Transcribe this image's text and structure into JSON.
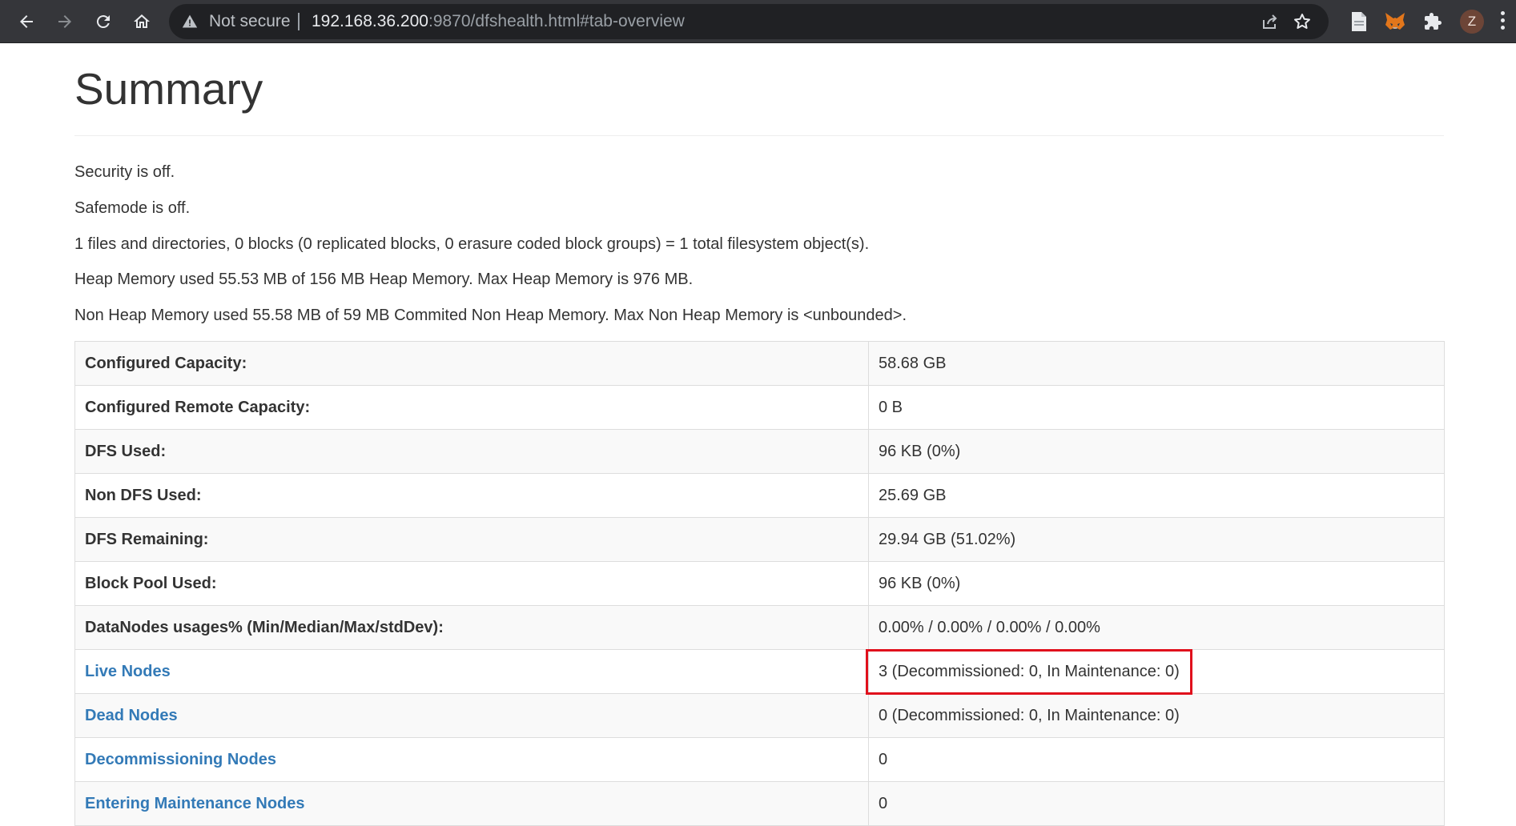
{
  "browser": {
    "not_secure_label": "Not secure",
    "url_host": "192.168.36.200",
    "url_rest": ":9870/dfshealth.html#tab-overview",
    "profile_initial": "Z",
    "icons": {
      "back": "arrow-left-icon",
      "forward": "arrow-right-icon",
      "reload": "reload-icon",
      "home": "home-icon",
      "warning": "warning-triangle-icon",
      "share": "share-icon",
      "bookmark": "star-icon",
      "document": "document-icon",
      "metamask": "fox-extension-icon",
      "extensions": "puzzle-icon",
      "menu": "kebab-menu-icon"
    }
  },
  "page": {
    "title": "Summary",
    "info": [
      "Security is off.",
      "Safemode is off.",
      "1 files and directories, 0 blocks (0 replicated blocks, 0 erasure coded block groups) = 1 total filesystem object(s).",
      "Heap Memory used 55.53 MB of 156 MB Heap Memory. Max Heap Memory is 976 MB.",
      "Non Heap Memory used 55.58 MB of 59 MB Commited Non Heap Memory. Max Non Heap Memory is <unbounded>."
    ],
    "rows": [
      {
        "label": "Configured Capacity:",
        "value": "58.68 GB"
      },
      {
        "label": "Configured Remote Capacity:",
        "value": "0 B"
      },
      {
        "label": "DFS Used:",
        "value": "96 KB (0%)"
      },
      {
        "label": "Non DFS Used:",
        "value": "25.69 GB"
      },
      {
        "label": "DFS Remaining:",
        "value": "29.94 GB (51.02%)"
      },
      {
        "label": "Block Pool Used:",
        "value": "96 KB (0%)"
      },
      {
        "label": "DataNodes usages% (Min/Median/Max/stdDev):",
        "value": "0.00% / 0.00% / 0.00% / 0.00%"
      },
      {
        "label": "Live Nodes",
        "value": "3 (Decommissioned: 0, In Maintenance: 0)"
      },
      {
        "label": "Dead Nodes",
        "value": "0 (Decommissioned: 0, In Maintenance: 0)"
      },
      {
        "label": "Decommissioning Nodes",
        "value": "0"
      },
      {
        "label": "Entering Maintenance Nodes",
        "value": "0"
      }
    ]
  },
  "colors": {
    "link": "#337ab7",
    "highlight_box": "#e0101c",
    "chrome_bg": "#35363a"
  }
}
